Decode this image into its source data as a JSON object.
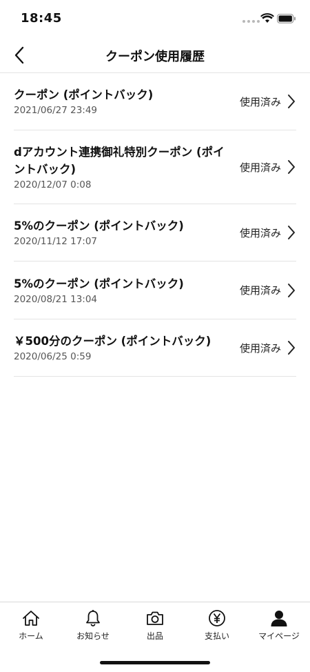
{
  "status_bar": {
    "time": "18:45"
  },
  "nav": {
    "title": "クーポン使用履歴"
  },
  "coupons": [
    {
      "name": "クーポン (ポイントバック)",
      "date": "2021/06/27 23:49",
      "status": "使用済み"
    },
    {
      "name": "dアカウント連携御礼特別クーポン (ポイントバック)",
      "date": "2020/12/07 0:08",
      "status": "使用済み"
    },
    {
      "name": "5%のクーポン (ポイントバック)",
      "date": "2020/11/12 17:07",
      "status": "使用済み"
    },
    {
      "name": "5%のクーポン (ポイントバック)",
      "date": "2020/08/21 13:04",
      "status": "使用済み"
    },
    {
      "name": "￥500分のクーポン (ポイントバック)",
      "date": "2020/06/25 0:59",
      "status": "使用済み"
    }
  ],
  "tab_bar": {
    "tabs": [
      {
        "label": "ホーム",
        "icon": "home-icon"
      },
      {
        "label": "お知らせ",
        "icon": "bell-icon"
      },
      {
        "label": "出品",
        "icon": "camera-icon"
      },
      {
        "label": "支払い",
        "icon": "yen-icon"
      },
      {
        "label": "マイページ",
        "icon": "person-icon"
      }
    ],
    "active_index": 4
  }
}
